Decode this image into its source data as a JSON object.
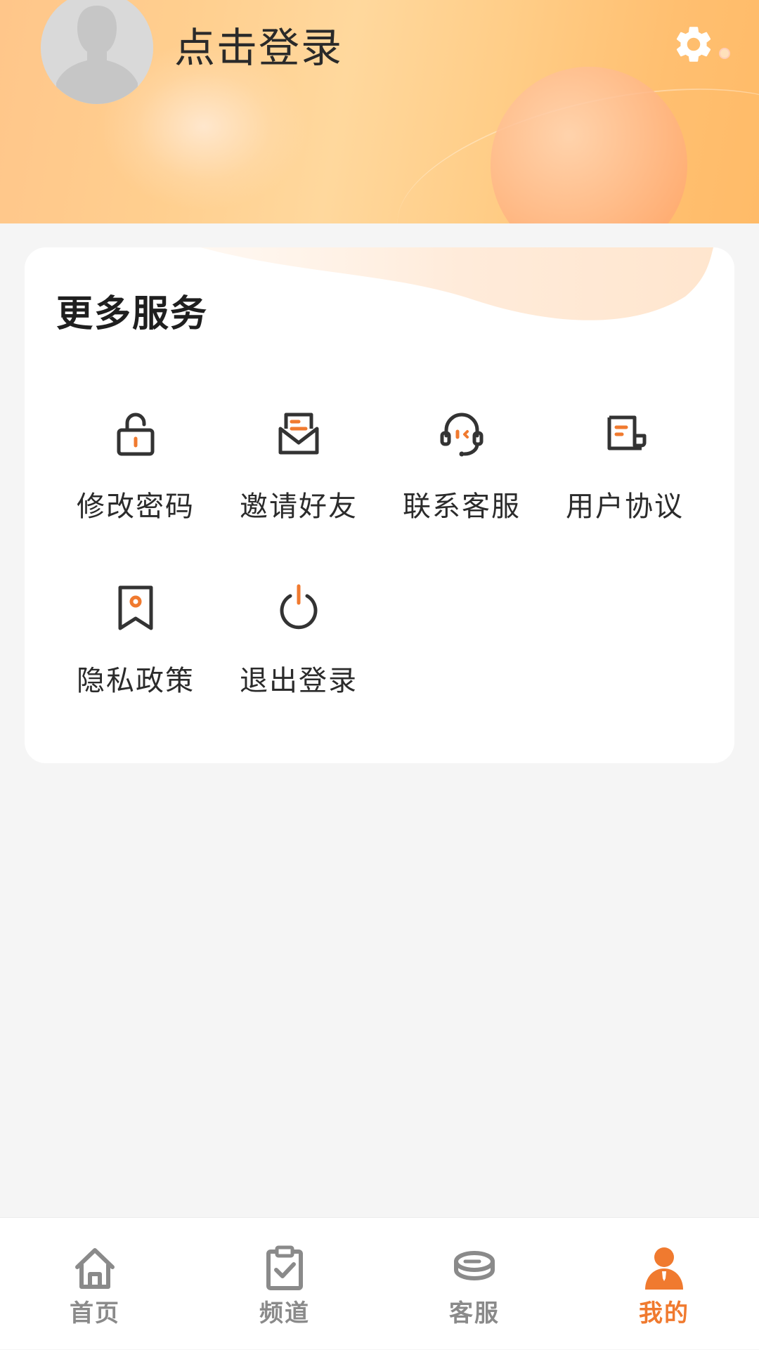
{
  "header": {
    "login_label": "点击登录",
    "avatar_icon": "user-avatar-icon",
    "settings_icon": "gear-icon",
    "gradient_colors": [
      "#ffc68a",
      "#ffd89d",
      "#ffbb68"
    ]
  },
  "services": {
    "title": "更多服务",
    "items": [
      {
        "label": "修改密码",
        "icon": "unlock-icon"
      },
      {
        "label": "邀请好友",
        "icon": "envelope-icon"
      },
      {
        "label": "联系客服",
        "icon": "headset-icon"
      },
      {
        "label": "用户协议",
        "icon": "document-icon"
      },
      {
        "label": "隐私政策",
        "icon": "bookmark-icon"
      },
      {
        "label": "退出登录",
        "icon": "power-icon"
      }
    ]
  },
  "tabbar": {
    "items": [
      {
        "label": "首页",
        "icon": "home-icon",
        "active": false
      },
      {
        "label": "频道",
        "icon": "clipboard-check-icon",
        "active": false
      },
      {
        "label": "客服",
        "icon": "stack-icon",
        "active": false
      },
      {
        "label": "我的",
        "icon": "person-icon",
        "active": true
      }
    ]
  },
  "colors": {
    "accent": "#f07a2f",
    "icon_dark": "#333333",
    "tab_inactive": "#8a8a8a",
    "background": "#f5f5f5"
  }
}
